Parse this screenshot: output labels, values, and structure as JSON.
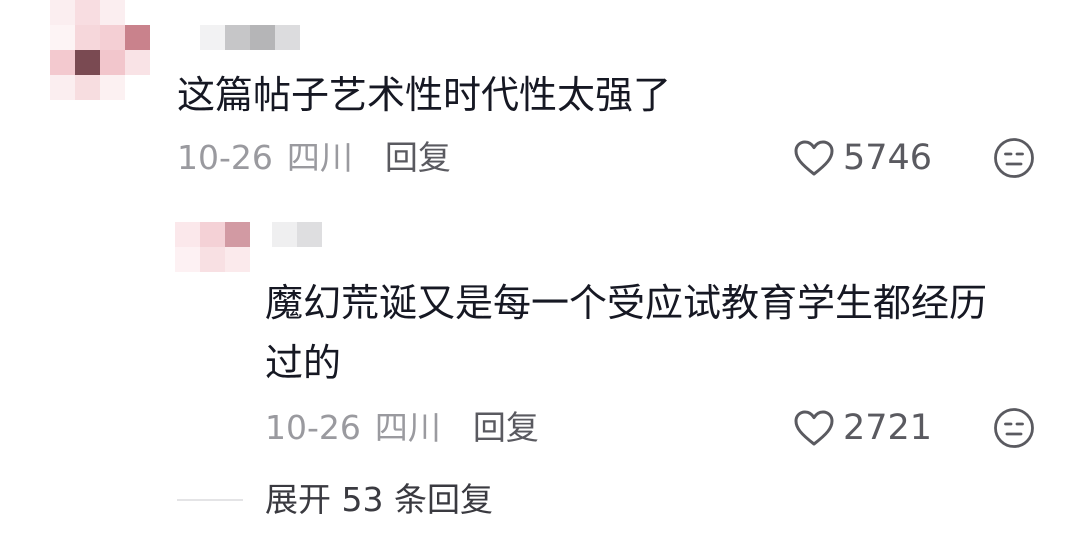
{
  "comment": {
    "text": "这篇帖子艺术性时代性太强了",
    "date": "10-26",
    "location": "四川",
    "reply_label": "回复",
    "like_count": "5746",
    "icons": {
      "like": "heart-outline-icon",
      "dislike": "meh-face-icon"
    }
  },
  "reply": {
    "text_line1": "魔幻荒诞又是每一个受应试教育学生都经历",
    "text_line2": "过的",
    "date": "10-26",
    "location": "四川",
    "reply_label": "回复",
    "like_count": "2721",
    "icons": {
      "like": "heart-outline-icon",
      "dislike": "meh-face-icon"
    }
  },
  "expand_replies": {
    "label": "展开 53 条回复"
  },
  "colors": {
    "text_primary": "#161823",
    "text_meta": "#9a9a9f",
    "text_secondary": "#5a5a60",
    "mosaic_pink": "#f3c9cf",
    "mosaic_rose": "#c9828c",
    "mosaic_dark": "#7a4a52",
    "mosaic_gray": "#b5b5b7"
  }
}
